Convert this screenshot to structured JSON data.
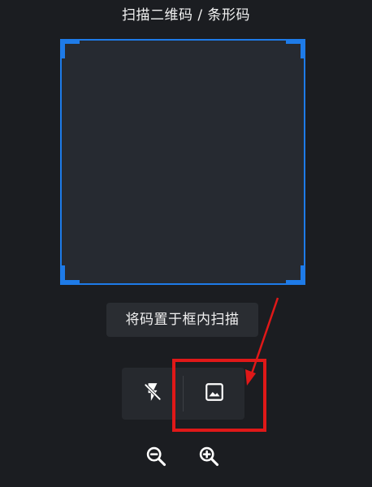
{
  "header": {
    "title": "扫描二维码 / 条形码"
  },
  "scanner": {
    "hint": "将码置于框内扫描",
    "frame_color": "#1e7be8"
  },
  "controls": {
    "flash_icon": "flash-off-icon",
    "gallery_icon": "image-icon"
  },
  "zoom": {
    "out_icon": "zoom-out-icon",
    "in_icon": "zoom-in-icon"
  },
  "annotation": {
    "highlight_color": "#e01818"
  }
}
